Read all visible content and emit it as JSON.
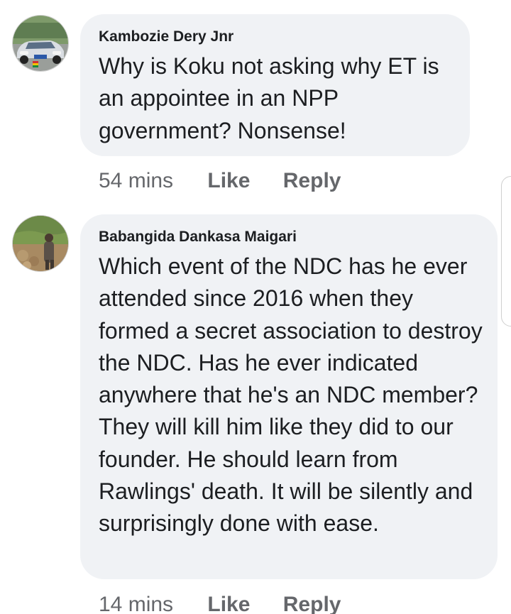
{
  "comments": [
    {
      "author": "Kambozie Dery Jnr",
      "text": "Why is Koku not asking why ET is an appointee in an NPP government? Nonsense!",
      "time": "54 mins",
      "like_label": "Like",
      "reply_label": "Reply",
      "avatar_icon": "car-photo-avatar"
    },
    {
      "author": "Babangida Dankasa Maigari",
      "text": "Which event of the NDC has he ever attended since 2016 when they formed a secret association to destroy the NDC. Has he ever indicated anywhere that he's an NDC member? They will kill him like they did to our founder. He should learn from Rawlings' death. It will be silently and surprisingly done with ease.",
      "time": "14 mins",
      "like_label": "Like",
      "reply_label": "Reply",
      "avatar_icon": "outdoor-photo-avatar"
    }
  ],
  "colors": {
    "bubble": "#f0f2f5",
    "text": "#1c1e21",
    "meta": "#65676b"
  }
}
